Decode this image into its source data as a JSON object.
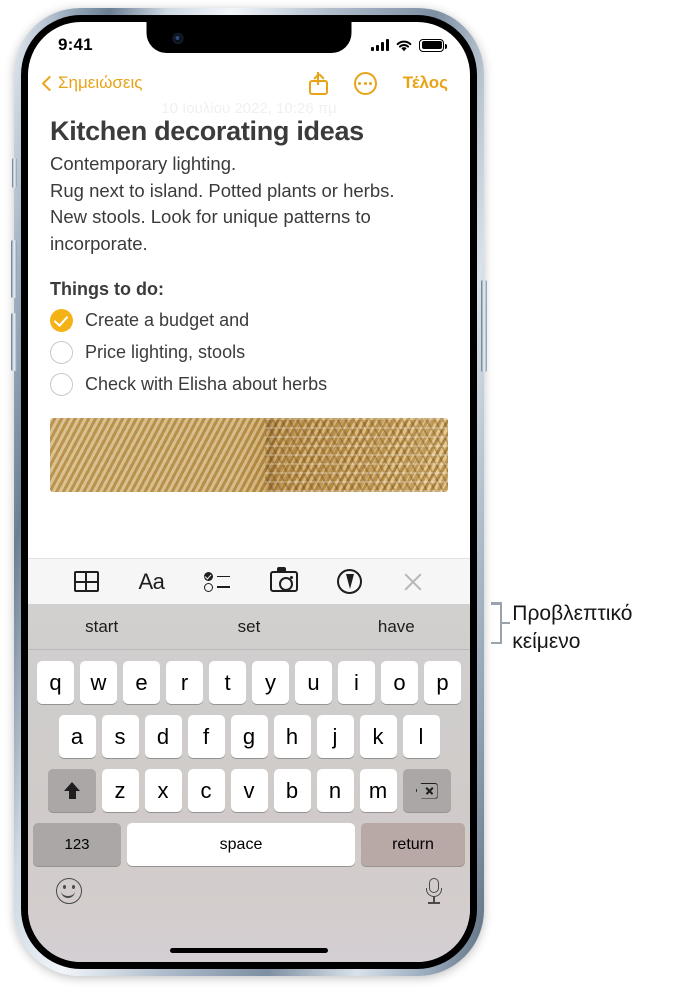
{
  "status_bar": {
    "time": "9:41",
    "icons": [
      "cellular-signal-icon",
      "wifi-icon",
      "battery-icon"
    ]
  },
  "nav_bar": {
    "back_label": "Σημειώσεις",
    "back_icon": "chevron-left-icon",
    "share_icon": "share-icon",
    "more_icon": "more-circle-icon",
    "done_label": "Τέλος"
  },
  "note": {
    "date": "10 Ιουλίου 2022, 10:26 πμ",
    "title": "Kitchen decorating ideas",
    "paragraph_lines": [
      "Contemporary lighting.",
      "Rug next to island.  Potted plants or herbs.",
      "New stools. Look for unique patterns to",
      "incorporate."
    ],
    "subheading": "Things to do:",
    "todos": [
      {
        "label": "Create a budget and",
        "checked": true
      },
      {
        "label": "Price lighting, stools",
        "checked": false
      },
      {
        "label": "Check with Elisha about herbs",
        "checked": false
      }
    ],
    "attachment_name": "woven-basket-photo"
  },
  "format_toolbar": {
    "items": [
      {
        "name": "table-icon",
        "label": ""
      },
      {
        "name": "text-format-icon",
        "label": "Aa"
      },
      {
        "name": "checklist-icon",
        "label": ""
      },
      {
        "name": "camera-icon",
        "label": ""
      },
      {
        "name": "markup-pen-icon",
        "label": ""
      },
      {
        "name": "close-icon",
        "label": ""
      }
    ]
  },
  "keyboard": {
    "predictive": [
      "start",
      "set",
      "have"
    ],
    "row1": [
      "q",
      "w",
      "e",
      "r",
      "t",
      "y",
      "u",
      "i",
      "o",
      "p"
    ],
    "row2": [
      "a",
      "s",
      "d",
      "f",
      "g",
      "h",
      "j",
      "k",
      "l"
    ],
    "row3": [
      "z",
      "x",
      "c",
      "v",
      "b",
      "n",
      "m"
    ],
    "shift_icon": "shift-icon",
    "delete_icon": "backspace-icon",
    "numbers_label": "123",
    "space_label": "space",
    "return_label": "return",
    "emoji_icon": "emoji-smiley-icon",
    "dictation_icon": "microphone-icon"
  },
  "callout": {
    "text": "Προβλεπτικό κείμενο"
  },
  "colors": {
    "accent": "#E8A317",
    "checkbox_on": "#F5B214",
    "text": "#3b3b3b",
    "callout_line": "#9aa2ab"
  }
}
